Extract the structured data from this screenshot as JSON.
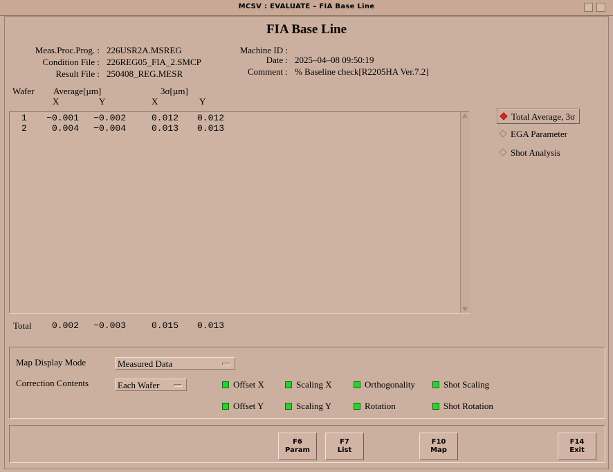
{
  "window": {
    "title": "MCSV : EVALUATE – FIA Base Line"
  },
  "page": {
    "title": "FIA Base Line"
  },
  "info": {
    "meas_proc_prog_label": "Meas.Proc.Prog. :",
    "meas_proc_prog": "226USR2A.MSREG",
    "condition_file_label": "Condition File :",
    "condition_file": "226REG05_FIA_2.SMCP",
    "result_file_label": "Result File :",
    "result_file": "250408_REG.MESR",
    "machine_id_label": "Machine ID :",
    "machine_id": "",
    "date_label": "Date :",
    "date": "2025–04–08 09:50:19",
    "comment_label": "Comment :",
    "comment": "% Baseline check[R2205HA Ver.7.2]"
  },
  "table": {
    "col_wafer": "Wafer",
    "col_average": "Average[µm]",
    "col_sigma": "3σ[µm]",
    "sub_x": "X",
    "sub_y": "Y",
    "rows": [
      {
        "wafer": "1",
        "avg_x": "−0.001",
        "avg_y": "−0.002",
        "sig_x": "0.012",
        "sig_y": "0.012"
      },
      {
        "wafer": "2",
        "avg_x": "0.004",
        "avg_y": "−0.004",
        "sig_x": "0.013",
        "sig_y": "0.013"
      }
    ],
    "total": {
      "label": "Total",
      "avg_x": "0.002",
      "avg_y": "−0.003",
      "sig_x": "0.015",
      "sig_y": "0.013"
    }
  },
  "view_options": [
    {
      "label": "Total Average, 3σ",
      "selected": true
    },
    {
      "label": "EGA Parameter",
      "selected": false
    },
    {
      "label": "Shot Analysis",
      "selected": false
    }
  ],
  "map_display": {
    "label": "Map Display Mode",
    "value": "Measured Data"
  },
  "correction": {
    "label": "Correction Contents",
    "value": "Each Wafer",
    "items": [
      {
        "label": "Offset X",
        "on": true
      },
      {
        "label": "Scaling X",
        "on": true
      },
      {
        "label": "Orthogonality",
        "on": true
      },
      {
        "label": "Shot Scaling",
        "on": true
      },
      {
        "label": "Offset Y",
        "on": true
      },
      {
        "label": "Scaling Y",
        "on": true
      },
      {
        "label": "Rotation",
        "on": true
      },
      {
        "label": "Shot Rotation",
        "on": true
      }
    ]
  },
  "fkeys": [
    {
      "key": "F6",
      "label": "Param"
    },
    {
      "key": "F7",
      "label": "List"
    },
    {
      "key": "F10",
      "label": "Map"
    },
    {
      "key": "F14",
      "label": "Exit"
    }
  ],
  "colors": {
    "background": "#ccb09f",
    "selected_radio": "#e0241a",
    "led_on": "#22d62a"
  }
}
